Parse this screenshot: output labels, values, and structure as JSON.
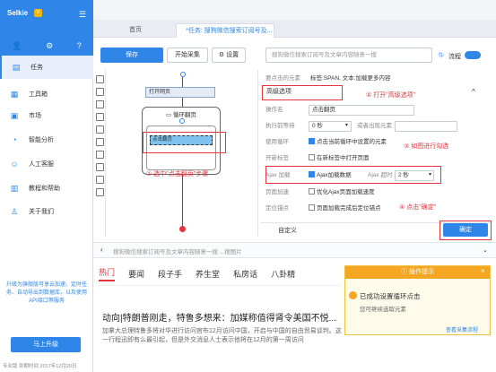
{
  "app": {
    "brand": "Selkie",
    "vip_badge": "V",
    "menu_icon": "hamburger-icon",
    "tab_home": "首页",
    "tab_task": "*任务: 搜狗微信搜索订阅号及...",
    "icons": [
      "user-icon",
      "gear-icon",
      "help-icon"
    ]
  },
  "sidebar": {
    "items": [
      {
        "label": "任务",
        "icon": "task-icon"
      },
      {
        "label": "工具箱",
        "icon": "toolbox-icon"
      },
      {
        "label": "市场",
        "icon": "market-icon"
      },
      {
        "label": "智能分析",
        "icon": "analysis-icon"
      },
      {
        "label": "人工客服",
        "icon": "support-icon"
      },
      {
        "label": "教程和帮助",
        "icon": "tutorial-icon"
      },
      {
        "label": "关于我们",
        "icon": "about-icon"
      }
    ],
    "promo": "升级为旗舰版可享云加速、定时任务、自动导出到数据库，以及使用API接口等服务",
    "upgrade": "马上升级",
    "status": "专业版  到期时间 2017年12月20日"
  },
  "toolbar": {
    "save": "保存",
    "start": "开始采集",
    "settings": "设置",
    "search_placeholder": "搜狗微信搜索订阅号及文章内容随意一搜",
    "flow_label": "流程"
  },
  "workflow": {
    "open_page": "打开网页",
    "loop_page": "循环翻页",
    "click_page": "点击翻页"
  },
  "panel": {
    "element_label": "要点击的元素",
    "element_value": "标签:SPAN, 文本:加载更多内容",
    "advanced": "高级选项",
    "op_name_label": "操作名",
    "op_name": "点击翻页",
    "wait_label": "执行前等待",
    "wait_value": "0 秒",
    "wait_or": "或者出现元素",
    "loop_label": "使用循环",
    "loop_text": "点击当前循环中设置的元素",
    "newtab_label": "开新标签",
    "newtab_text": "在新标签中打开页面",
    "ajax_label": "Ajax 加载",
    "ajax_text": "Ajax加载数据",
    "ajax_timeout_label": "Ajax 超时",
    "ajax_timeout": "2 秒",
    "speed_label": "页面加速",
    "speed_text": "优化Ajax页面加载速度",
    "pos_label": "定位锚点",
    "pos_text": "页面加载完成后定位锚点",
    "custom": "自定义",
    "confirm": "确定"
  },
  "annotations": {
    "step1": "① 选中\"点击翻页\"步骤",
    "step2": "② 打开\"高级选项\"",
    "step3": "③ 如图进行勾选",
    "step4": "④ 点击\"确定\""
  },
  "browser": {
    "url_placeholder": "搜狗微信搜索订阅号及文章内容随意一搜 ...搜图片",
    "tabs": [
      "热门",
      "要闻",
      "段子手",
      "养生堂",
      "私房话",
      "八卦精"
    ],
    "headline": "动向|特朗普刚走，特鲁多想来：加媒称值得肾令美国不悦...",
    "para": "加拿大总理特鲁多将对华进行访问官布12月访问中国，开启与中国的自由贸易谈判。这一行程迅即有么最引起，但是外交消息人士表示他将在12月的第一周访问"
  },
  "toast": {
    "title": "操作提示",
    "msg": "已成功设置循环点击",
    "sub": "您可继续选取元素",
    "link": "查看采集流程"
  }
}
